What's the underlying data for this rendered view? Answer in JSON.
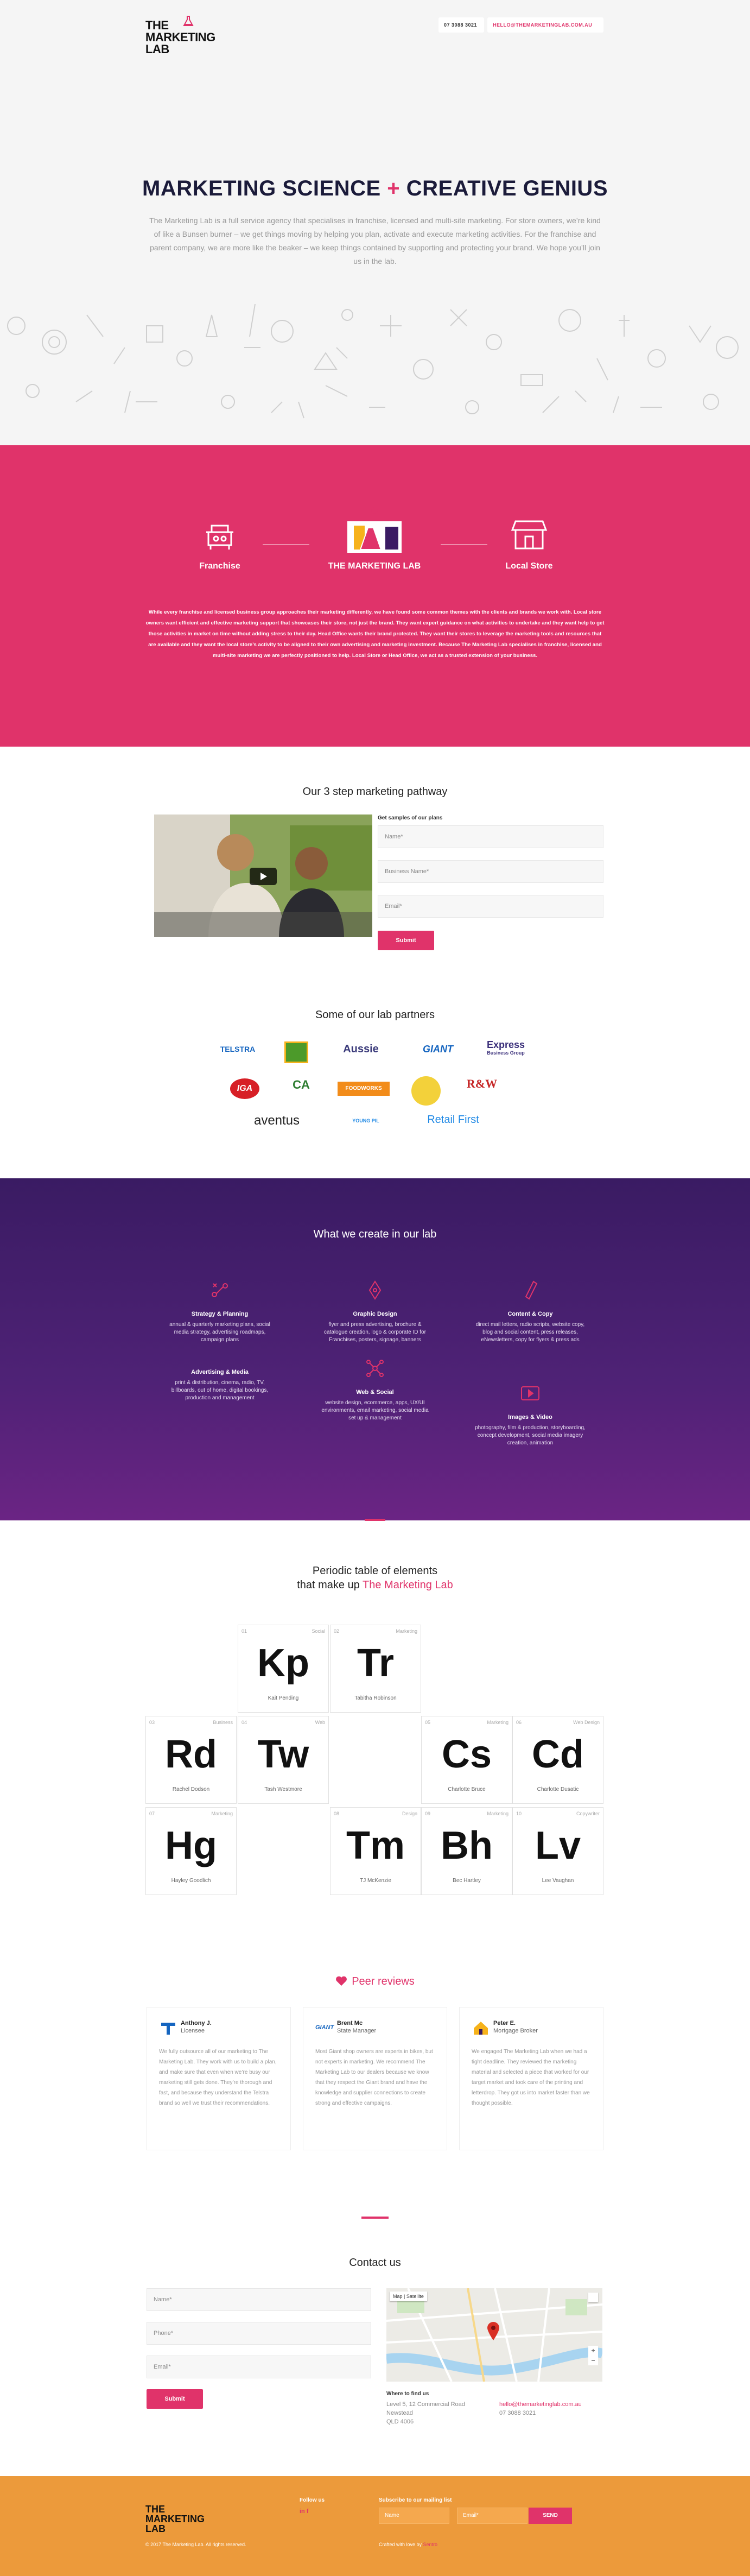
{
  "header": {
    "logo_line1": "THE",
    "logo_line2": "MARKETING LAB",
    "phone": "07 3088 3021",
    "email": "HELLO@THEMARKETINGLAB.COM.AU"
  },
  "hero": {
    "title_a": "MARKETING SCIENCE",
    "title_plus": "+",
    "title_b": "CREATIVE GENIUS",
    "text": "The Marketing Lab is a full service agency that specialises in franchise, licensed and multi-site marketing. For store owners, we’re kind of like a Bunsen burner – we get things moving by helping you plan, activate and execute marketing activities. For the franchise and parent company, we are more like the beaker – we keep things contained by supporting and protecting your brand. We hope you’ll join us in the lab."
  },
  "pink": {
    "left_label": "Franchise",
    "center_label": "THE MARKETING LAB",
    "right_label": "Local Store",
    "text": "While every franchise and licensed business group approaches their marketing differently, we have found some common themes with the clients and brands we work with. Local store owners want efficient and effective marketing support that showcases their store, not just the brand. They want expert guidance on what activities to undertake and they want help to get those activities in market on time without adding stress to their day. Head Office wants their brand protected. They want their stores to leverage the marketing tools and resources that are available and they want the local store’s activity to be aligned to their own advertising and marketing investment. Because The Marketing Lab specialises in franchise, licensed and multi-site marketing we are perfectly positioned to help. Local Store or Head Office, we act as a trusted extension of your business."
  },
  "pathway": {
    "title": "Our 3 step marketing pathway",
    "form_label": "Get samples of our plans",
    "name_ph": "Name*",
    "business_ph": "Business Name*",
    "email_ph": "Email*",
    "submit": "Submit"
  },
  "partners": {
    "title": "Some of our lab partners",
    "items": [
      "TELSTRA",
      "Aussie",
      "GIANT",
      "Express",
      "IGA",
      "CA",
      "FOODWORKS",
      "R&W",
      "aventus",
      "YOUNG PIL",
      "Retail First"
    ],
    "express_sub": "Business Group"
  },
  "create": {
    "title": "What we create in our lab",
    "cards": [
      {
        "h": "Strategy & Planning",
        "t": "annual & quarterly marketing plans, social media strategy, advertising roadmaps, campaign plans"
      },
      {
        "h": "Graphic Design",
        "t": "flyer and press advertising, brochure & catalogue creation, logo & corporate ID for Franchises, posters, signage, banners"
      },
      {
        "h": "Content & Copy",
        "t": "direct mail letters, radio scripts, website copy, blog and social content, press releases, eNewsletters, copy for flyers & press ads"
      },
      {
        "h": "Advertising & Media",
        "t": "print & distribution, cinema, radio, TV, billboards, out of home, digital bookings, production and management"
      },
      {
        "h": "Web & Social",
        "t": "website design, ecommerce, apps, UX/UI environments, email marketing, social media set up & management"
      },
      {
        "h": "Images & Video",
        "t": "photography, film & production, storyboarding, concept development, social media imagery creation, animation"
      }
    ]
  },
  "periodic": {
    "title_line1": "Periodic table of elements",
    "title_line2a": "that make up ",
    "title_line2b": "The Marketing Lab",
    "elements": [
      {
        "num": "01",
        "role": "Social",
        "sym": "Kp",
        "name": "Kait Pending"
      },
      {
        "num": "02",
        "role": "Marketing",
        "sym": "Tr",
        "name": "Tabitha Robinson"
      },
      {
        "num": "03",
        "role": "Business",
        "sym": "Rd",
        "name": "Rachel Dodson"
      },
      {
        "num": "04",
        "role": "Web",
        "sym": "Tw",
        "name": "Tash Westmore"
      },
      {
        "num": "05",
        "role": "Marketing",
        "sym": "Cs",
        "name": "Charlotte Bruce"
      },
      {
        "num": "06",
        "role": "Web Design",
        "sym": "Cd",
        "name": "Charlotte Dusatic"
      },
      {
        "num": "07",
        "role": "Marketing",
        "sym": "Hg",
        "name": "Hayley Goodlich"
      },
      {
        "num": "08",
        "role": "Design",
        "sym": "Tm",
        "name": "TJ McKenzie"
      },
      {
        "num": "09",
        "role": "Marketing",
        "sym": "Bh",
        "name": "Bec Hartley"
      },
      {
        "num": "10",
        "role": "Copywriter",
        "sym": "Lv",
        "name": "Lee Vaughan"
      }
    ]
  },
  "reviews": {
    "title": "Peer reviews",
    "items": [
      {
        "name": "Anthony J.",
        "role": "Licensee",
        "text": "We fully outsource all of our marketing to The Marketing Lab. They work with us to build a plan, and make sure that even when we’re busy our marketing still gets done. They’re thorough and fast, and because they understand the Telstra brand so well we trust their recommendations."
      },
      {
        "name": "Brent Mc",
        "role": "State Manager",
        "text": "Most Giant shop owners are experts in bikes, but not experts in marketing. We recommend The Marketing Lab to our dealers because we know that they respect the Giant brand and have the knowledge and supplier connections to create strong and effective campaigns."
      },
      {
        "name": "Peter E.",
        "role": "Mortgage Broker",
        "text": "We engaged The Marketing Lab when we had a tight deadline. They reviewed the marketing material and selected a piece that worked for our target market and took care of the printing and letterdrop. They got us into market faster than we thought possible."
      }
    ]
  },
  "contact": {
    "title": "Contact us",
    "name_ph": "Name*",
    "phone_ph": "Phone*",
    "email_ph": "Email*",
    "submit": "Submit",
    "where_label": "Where to find us",
    "addr1": "Level 5, 12 Commercial Road",
    "addr2": "Newstead",
    "addr3": "QLD 4006",
    "email": "hello@themarketinglab.com.au",
    "phone": "07 3088 3021",
    "map_btn1": "Map",
    "map_btn2": "Satellite"
  },
  "footer": {
    "follow": "Follow us",
    "subscribe": "Subscribe to our mailing list",
    "name_ph": "Name",
    "email_ph": "Email*",
    "send": "SEND",
    "copyright": "© 2017 The Marketing Lab. All rights reserved.",
    "credit_a": "Crafted with love by ",
    "credit_b": "Sentro"
  },
  "colors": {
    "accent": "#e0336a",
    "purple": "#3a1b63",
    "orange": "#ec9a3b"
  }
}
